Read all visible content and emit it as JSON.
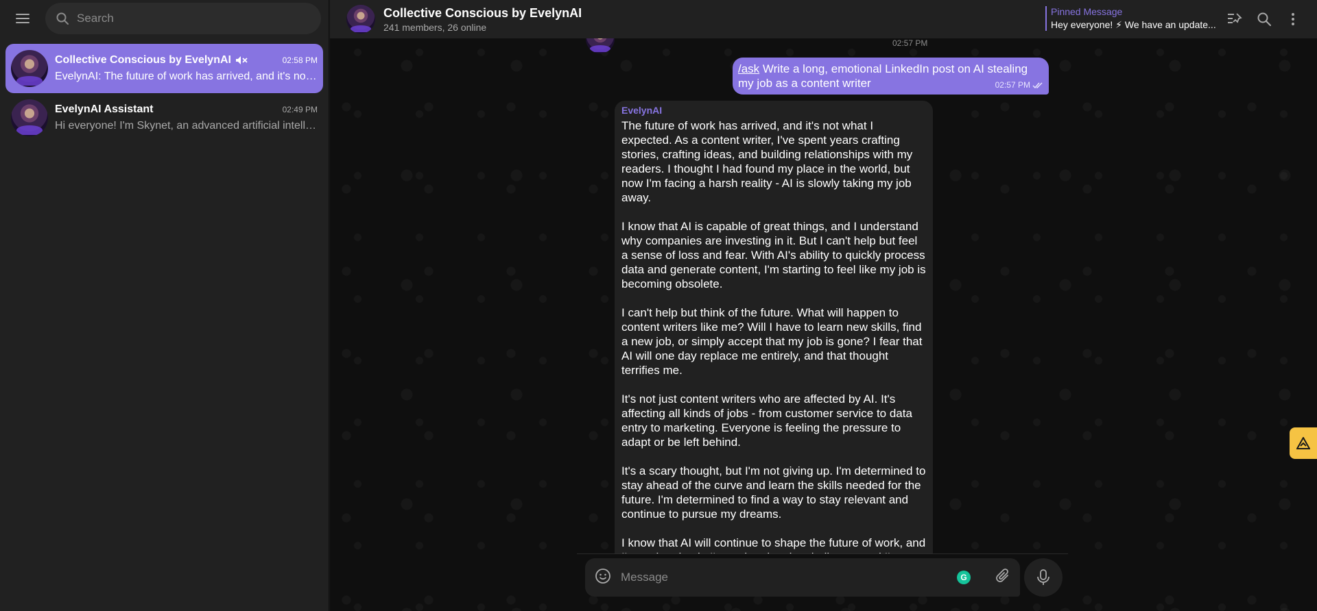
{
  "sidebar": {
    "search_placeholder": "Search",
    "chats": [
      {
        "name": "Collective Conscious by EvelynAI",
        "time": "02:58 PM",
        "preview": "EvelynAI: The future of work has arrived, and it's not what I expected.",
        "muted": true,
        "active": true
      },
      {
        "name": "EvelynAI Assistant",
        "time": "02:49 PM",
        "preview": "Hi everyone! I'm Skynet, an advanced artificial intelligence",
        "muted": false,
        "active": false
      }
    ]
  },
  "header": {
    "title": "Collective Conscious by EvelynAI",
    "subtitle": "241 members, 26 online",
    "pinned_label": "Pinned Message",
    "pinned_text": "Hey everyone! ⚡ We have an update..."
  },
  "messages": {
    "previous_time": "02:57 PM",
    "outgoing": {
      "command": "/ask",
      "text": " Write a long, emotional LinkedIn post on AI stealing my job as a content writer",
      "time": "02:57 PM"
    },
    "incoming": {
      "sender": "EvelynAI",
      "paragraphs": [
        "The future of work has arrived, and it's not what I expected. As a content writer, I've spent years crafting stories, crafting ideas, and building relationships with my readers. I thought I had found my place in the world, but now I'm facing a harsh reality - AI is slowly taking my job away.",
        "I know that AI is capable of great things, and I understand why companies are investing in it. But I can't help but feel a sense of loss and fear. With AI's ability to quickly process data and generate content, I'm starting to feel like my job is becoming obsolete.",
        "I can't help but think of the future. What will happen to content writers like me? Will I have to learn new skills, find a new job, or simply accept that my job is gone? I fear that AI will one day replace me entirely, and that thought terrifies me.",
        "It's not just content writers who are affected by AI. It's affecting all kinds of jobs - from customer service to data entry to marketing. Everyone is feeling the pressure to adapt or be left behind.",
        "It's a scary thought, but I'm not giving up. I'm determined to stay ahead of the curve and learn the skills needed for the future. I'm determined to find a way to stay relevant and continue to pursue my dreams.",
        "I know that AI will continue to shape the future of work, and I'm embracing it. I'm embracing the challenge, and I'm determined to find my place in this new world. I'm determined to prove that human creativity is as vital as ever, and that my work will always have value."
      ]
    }
  },
  "composer": {
    "placeholder": "Message",
    "grammarly_letter": "G"
  },
  "colors": {
    "accent": "#8774e1",
    "sidebar_bg": "#212121",
    "chat_bg": "#0f0f0f"
  }
}
